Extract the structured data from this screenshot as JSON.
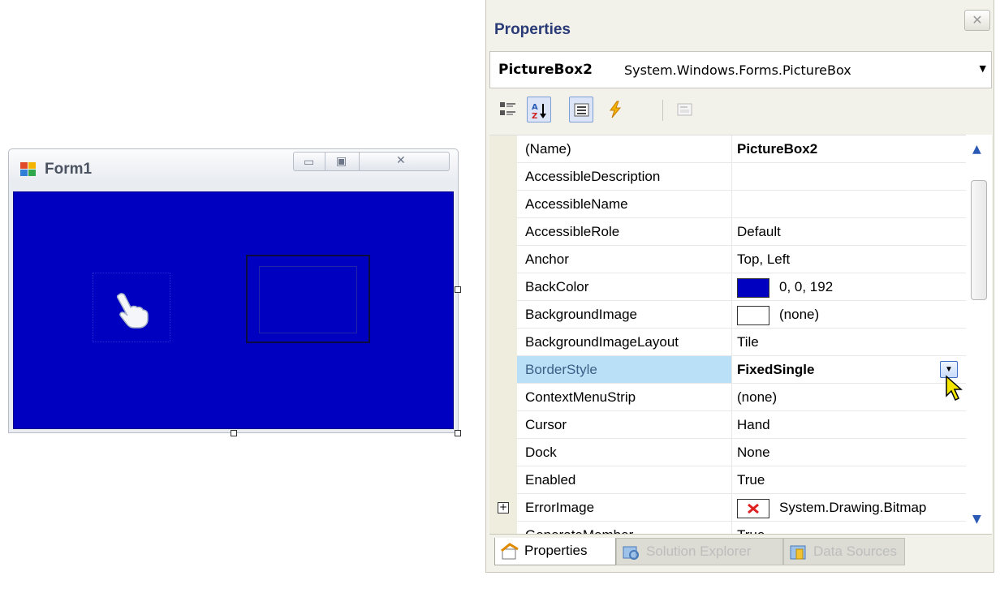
{
  "form1": {
    "title": "Form1",
    "back_color": "#0000c0"
  },
  "properties": {
    "title": "Properties",
    "object": {
      "name": "PictureBox2",
      "type": "System.Windows.Forms.PictureBox"
    },
    "rows": [
      {
        "name": "(Name)",
        "value": "PictureBox2",
        "bold": true
      },
      {
        "name": "AccessibleDescription",
        "value": ""
      },
      {
        "name": "AccessibleName",
        "value": ""
      },
      {
        "name": "AccessibleRole",
        "value": "Default"
      },
      {
        "name": "Anchor",
        "value": "Top, Left"
      },
      {
        "name": "BackColor",
        "value": "0, 0, 192",
        "swatch": "#0000c0"
      },
      {
        "name": "BackgroundImage",
        "value": "(none)",
        "swatch": "#ffffff"
      },
      {
        "name": "BackgroundImageLayout",
        "value": "Tile"
      },
      {
        "name": "BorderStyle",
        "value": "FixedSingle",
        "bold": true,
        "selected": true,
        "dropdown": true
      },
      {
        "name": "ContextMenuStrip",
        "value": "(none)"
      },
      {
        "name": "Cursor",
        "value": "Hand"
      },
      {
        "name": "Dock",
        "value": "None"
      },
      {
        "name": "Enabled",
        "value": "True"
      },
      {
        "name": "ErrorImage",
        "value": "System.Drawing.Bitmap",
        "expander": "+",
        "error_icon": true
      },
      {
        "name": "GenerateMember",
        "value": "True"
      }
    ],
    "tabs": [
      {
        "label": "Properties"
      },
      {
        "label": "Solution Explorer"
      },
      {
        "label": "Data Sources"
      }
    ]
  }
}
